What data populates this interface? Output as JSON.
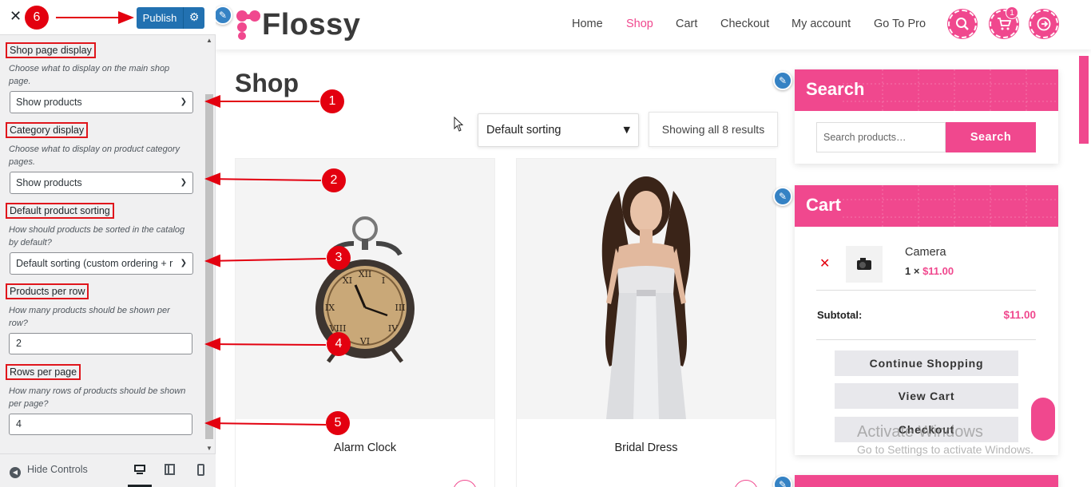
{
  "sidebar": {
    "close_icon": "close-icon",
    "publish_label": "Publish",
    "fields": {
      "shop_display": {
        "label": "Shop page display",
        "description": "Choose what to display on the main shop page.",
        "value": "Show products"
      },
      "category_display": {
        "label": "Category display",
        "description": "Choose what to display on product category pages.",
        "value": "Show products"
      },
      "default_sorting": {
        "label": "Default product sorting",
        "description": "How should products be sorted in the catalog by default?",
        "value": "Default sorting (custom ordering + r"
      },
      "products_per_row": {
        "label": "Products per row",
        "description": "How many products should be shown per row?",
        "value": "2"
      },
      "rows_per_page": {
        "label": "Rows per page",
        "description": "How many rows of products should be shown per page?",
        "value": "4"
      }
    },
    "footer": {
      "hide_controls_label": "Hide Controls",
      "devices": [
        "desktop",
        "tablet",
        "mobile"
      ]
    }
  },
  "annotations": [
    "1",
    "2",
    "3",
    "4",
    "5",
    "6"
  ],
  "site": {
    "logo_text": "Flossy",
    "nav": [
      "Home",
      "Shop",
      "Cart",
      "Checkout",
      "My account",
      "Go To Pro"
    ],
    "active_nav": "Shop",
    "header_icons": [
      "search-icon",
      "cart-icon",
      "logout-icon"
    ],
    "cart_count": "1",
    "page_title": "Shop",
    "sorting_value": "Default sorting",
    "result_count": "Showing all 8 results",
    "products": [
      {
        "name": "Alarm Clock",
        "image": "alarm-clock-image"
      },
      {
        "name": "Bridal Dress",
        "image": "bridal-dress-image"
      }
    ],
    "search_widget": {
      "title": "Search",
      "placeholder": "Search products…",
      "button": "Search"
    },
    "cart_widget": {
      "title": "Cart",
      "item_name": "Camera",
      "item_qty": "1 ×",
      "item_price": "$11.00",
      "subtotal_label": "Subtotal:",
      "subtotal_value": "$11.00",
      "buttons": [
        "Continue Shopping",
        "View Cart",
        "Checkout"
      ]
    }
  },
  "watermark": {
    "title": "Activate Windows",
    "subtitle": "Go to Settings to activate Windows."
  },
  "colors": {
    "brand_pink": "#f0488e",
    "publish_blue": "#2271b1",
    "annotation_red": "#e3000f"
  }
}
